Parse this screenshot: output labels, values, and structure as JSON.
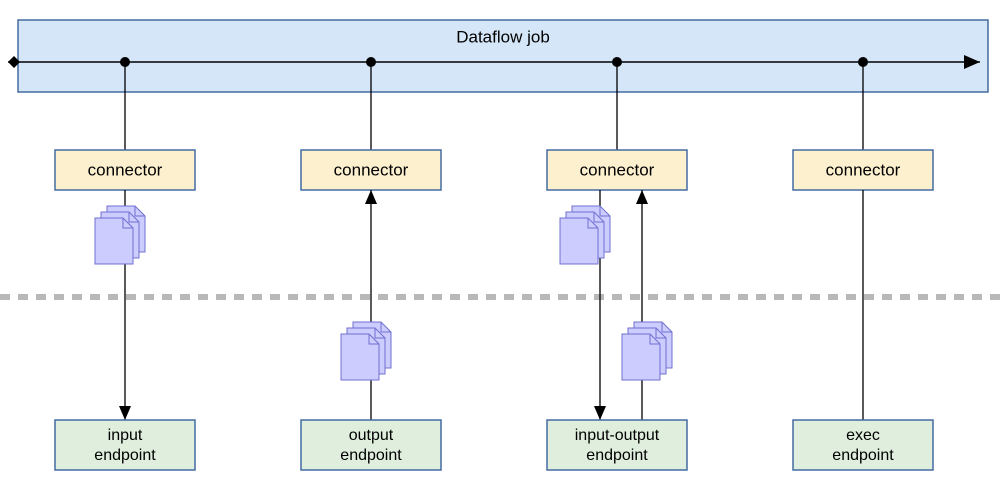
{
  "job": {
    "title": "Dataflow job"
  },
  "connectors": [
    {
      "label": "connector"
    },
    {
      "label": "connector"
    },
    {
      "label": "connector"
    },
    {
      "label": "connector"
    }
  ],
  "endpoints": [
    {
      "line1": "input",
      "line2": "endpoint"
    },
    {
      "line1": "output",
      "line2": "endpoint"
    },
    {
      "line1": "input-output",
      "line2": "endpoint"
    },
    {
      "line1": "exec",
      "line2": "endpoint"
    }
  ],
  "colors": {
    "jobFill": "#d4e6f7",
    "connectorFill": "#fdf0cf",
    "endpointFill": "#dfeedd",
    "docFill": "#ccccff",
    "boxStroke": "#436ca3"
  }
}
